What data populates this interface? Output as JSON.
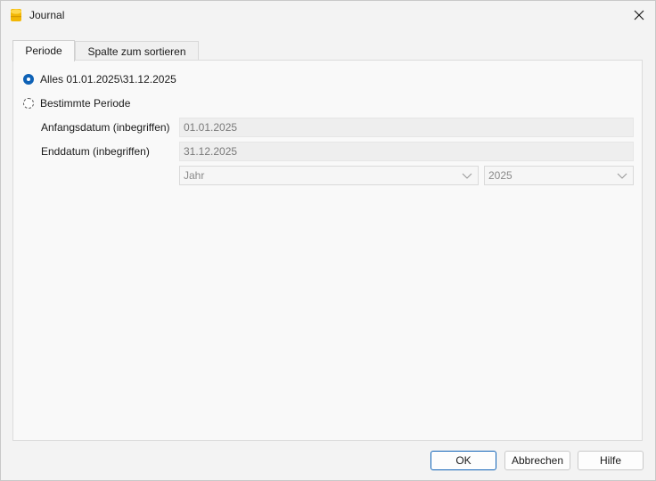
{
  "window": {
    "title": "Journal"
  },
  "tabs": [
    {
      "label": "Periode",
      "active": true
    },
    {
      "label": "Spalte zum sortieren",
      "active": false
    }
  ],
  "period": {
    "all_label": "Alles 01.01.2025\\31.12.2025",
    "all_selected": true,
    "specific_label": "Bestimmte Periode",
    "specific_selected": false,
    "start_label": "Anfangsdatum (inbegriffen)",
    "start_value": "01.01.2025",
    "end_label": "Enddatum (inbegriffen)",
    "end_value": "31.12.2025",
    "period_type": "Jahr",
    "year": "2025"
  },
  "buttons": {
    "ok": "OK",
    "cancel": "Abbrechen",
    "help": "Hilfe"
  },
  "colors": {
    "accent": "#0f62b6",
    "app_icon": "#f2b705"
  },
  "icons": {
    "app": "journal-app-icon",
    "close": "close-icon",
    "dropdown": "chevron-down-icon"
  }
}
